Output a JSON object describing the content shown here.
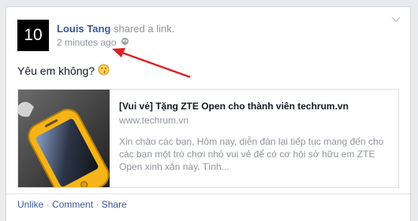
{
  "post": {
    "avatar_text": "10",
    "author": "Louis Tang",
    "action": " shared a link.",
    "timestamp": "2 minutes ago",
    "status": "Yêu em không?",
    "emoji_icon": "kiss-emoticon-icon"
  },
  "link": {
    "title": "[Vui vẻ] Tặng ZTE Open cho thành viên techrum.vn",
    "host": "www.techrum.vn",
    "description": "Xin chào các bạn, Hôm nay, diễn đàn lại tiếp tục mang đến cho các bạn một trò chơi nhỏ vui vẻ để có cơ hội sở hữu em ZTE Open xinh xắn này. Tình..."
  },
  "actions": {
    "unlike": "Unlike",
    "comment": "Comment",
    "share": "Share",
    "separator": " · "
  },
  "colors": {
    "link_blue": "#3b5998",
    "meta_gray": "#90949c",
    "annotation_arrow": "#e02020"
  },
  "icons": {
    "menu": "chevron-down-icon",
    "privacy": "globe-icon"
  }
}
